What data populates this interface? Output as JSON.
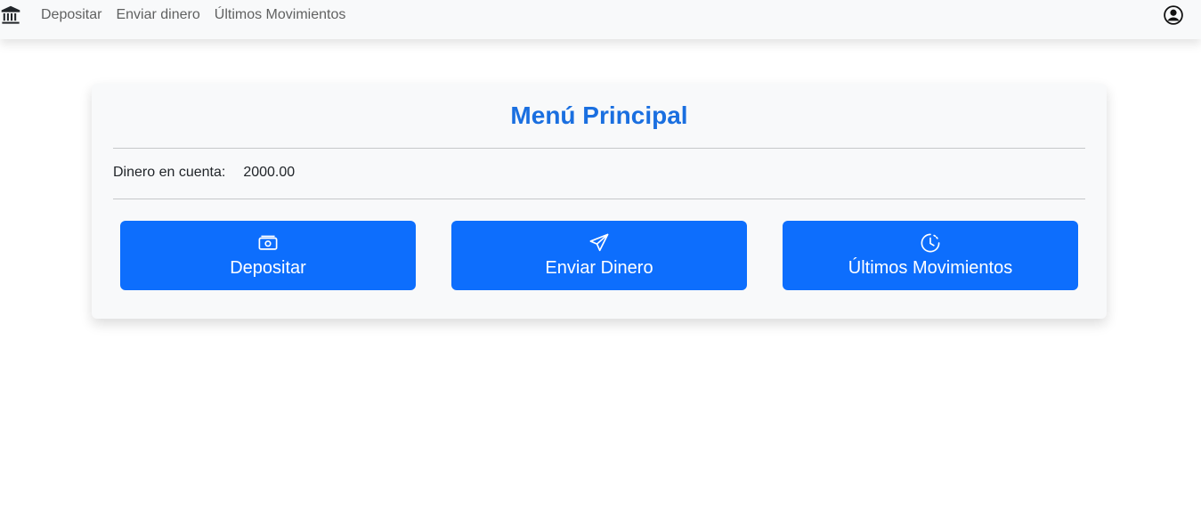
{
  "navbar": {
    "brand_icon": "bank-icon",
    "links": [
      {
        "label": "Depositar"
      },
      {
        "label": "Enviar dinero"
      },
      {
        "label": "Últimos Movimientos"
      }
    ],
    "user_icon": "person-circle-icon"
  },
  "main": {
    "title": "Menú Principal",
    "balance_label": "Dinero en cuenta:",
    "balance_value": "2000.00",
    "buttons": [
      {
        "label": "Depositar",
        "icon": "cash-icon"
      },
      {
        "label": "Enviar Dinero",
        "icon": "send-icon"
      },
      {
        "label": "Últimos Movimientos",
        "icon": "clock-history-icon"
      }
    ]
  },
  "colors": {
    "accent": "#0d6efd",
    "title": "#1a6fe0",
    "navbar_bg": "#f8f9fa",
    "card_bg": "#f8f9fa"
  }
}
